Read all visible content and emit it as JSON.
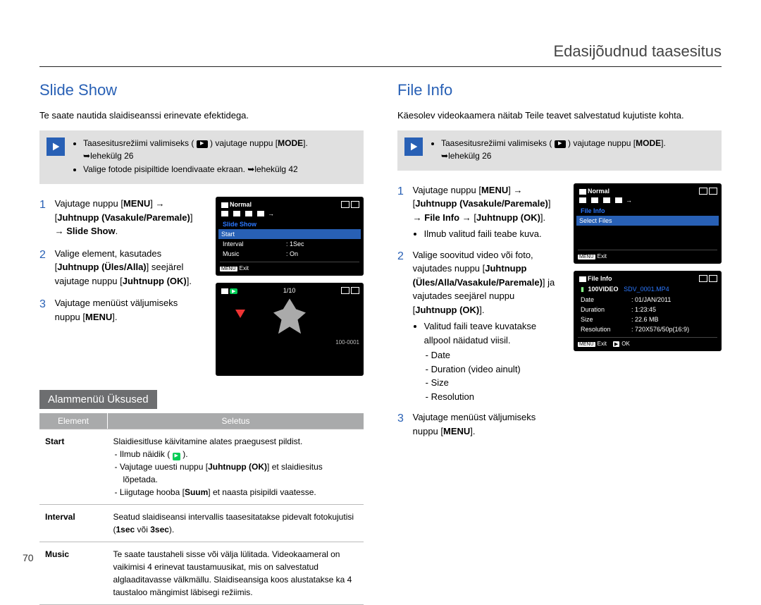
{
  "header": {
    "title": "Edasijõudnud taasesitus"
  },
  "page_number": "70",
  "left": {
    "title": "Slide Show",
    "intro": "Te saate nautida slaidiseanssi erinevate efektidega.",
    "tips": [
      {
        "pre": "Taasesitusrežiimi valimiseks ( ",
        "post": " ) vajutage nuppu [",
        "btn": "MODE",
        "end": "]."
      },
      {
        "link": "lehekülg 26"
      },
      {
        "text": "Valige fotode pisipiltide loendivaate ekraan. ",
        "link": "lehekülg 42"
      }
    ],
    "steps": [
      {
        "n": "1",
        "parts": [
          "Vajutage nuppu [",
          "MENU",
          "] → [",
          "Juhtnupp (Vasakule/Paremale)",
          "] → ",
          "Slide Show",
          "."
        ]
      },
      {
        "n": "2",
        "parts": [
          "Valige element, kasutades [",
          "Juhtnupp (Üles/Alla)",
          "] seejärel vajutage nuppu [",
          "Juhtnupp (OK)",
          "]."
        ]
      },
      {
        "n": "3",
        "parts": [
          "Vajutage menüüst väljumiseks nuppu [",
          "MENU",
          "]."
        ]
      }
    ],
    "menu_screen": {
      "mode": "Normal",
      "title": "Slide Show",
      "items": [
        {
          "label": "Start",
          "value": "",
          "hl": true
        },
        {
          "label": "Interval",
          "value": ": 1Sec"
        },
        {
          "label": "Music",
          "value": ": On"
        }
      ],
      "exit_kbd": "MENU",
      "exit_label": "Exit"
    },
    "play_screen": {
      "counter": "1/10",
      "footer": "100-0001"
    },
    "sub_title": "Alammenüü Üksused",
    "table": {
      "h1": "Element",
      "h2": "Seletus",
      "rows": [
        {
          "k": "Start",
          "intro": "Slaidiesitluse käivitamine alates praegusest pildist.",
          "bullets": [
            "Ilmub näidik ( ",
            "Vajutage uuesti nuppu [Juhtnupp (OK)] et slaidiesitus lõpetada.",
            "Liigutage hooba [Suum] et naasta pisipildi vaatesse."
          ],
          "icon_after_first": true
        },
        {
          "k": "Interval",
          "text": "Seatud slaidiseansi intervallis taasesitatakse pidevalt fotokujutisi (1sec või 3sec).",
          "bold_parts": [
            "1sec",
            "3sec"
          ]
        },
        {
          "k": "Music",
          "text": "Te saate taustaheli sisse või välja lülitada. Videokaameral on vaikimisi 4 erinevat taustamuusikat, mis on salvestatud alglaaditavasse välkmällu. Slaidiseansiga koos alustatakse ka 4 taustaloo mängimist läbisegi režiimis."
        }
      ]
    }
  },
  "right": {
    "title": "File Info",
    "intro": "Käesolev videokaamera näitab Teile teavet salvestatud kujutiste kohta.",
    "tips": [
      {
        "pre": "Taasesitusrežiimi valimiseks ( ",
        "post": " ) vajutage nuppu [",
        "btn": "MODE",
        "end": "]."
      },
      {
        "link": "lehekülg 26"
      }
    ],
    "steps": [
      {
        "n": "1",
        "parts": [
          "Vajutage nuppu [",
          "MENU",
          "] → [",
          "Juhtnupp (Vasakule/Paremale)",
          "] → ",
          "File Info",
          " → [",
          "Juhtnupp (OK)",
          "]."
        ],
        "bullets": [
          "Ilmub valitud faili teabe kuva."
        ]
      },
      {
        "n": "2",
        "parts": [
          "Valige soovitud video või foto, vajutades nuppu [",
          "Juhtnupp (Üles/Alla/Vasakule/Paremale)",
          "] ja vajutades seejärel nuppu [",
          "Juhtnupp (OK)",
          "]."
        ],
        "bullets_lead": "Valitud faili teave kuvatakse allpool näidatud viisil.",
        "bullets": [
          "Date",
          "Duration (video ainult)",
          "Size",
          "Resolution"
        ]
      },
      {
        "n": "3",
        "parts": [
          "Vajutage menüüst väljumiseks nuppu [",
          "MENU",
          "]."
        ]
      }
    ],
    "menu_screen": {
      "mode": "Normal",
      "title": "File Info",
      "items": [
        {
          "label": "Select Files",
          "value": "",
          "hl": true
        }
      ],
      "exit_kbd": "MENU",
      "exit_label": "Exit"
    },
    "info_screen": {
      "title": "File Info",
      "folder": "100VIDEO",
      "filename": "SDV_0001.MP4",
      "rows": [
        {
          "k": "Date",
          "v": ": 01/JAN/2011"
        },
        {
          "k": "Duration",
          "v": ": 1:23:45"
        },
        {
          "k": "Size",
          "v": ": 22.6 MB"
        },
        {
          "k": "Resolution",
          "v": ": 720X576/50p(16:9)"
        }
      ],
      "exit_kbd": "MENU",
      "exit_label": "Exit",
      "ok_kbd": "▶",
      "ok_label": "OK"
    }
  }
}
